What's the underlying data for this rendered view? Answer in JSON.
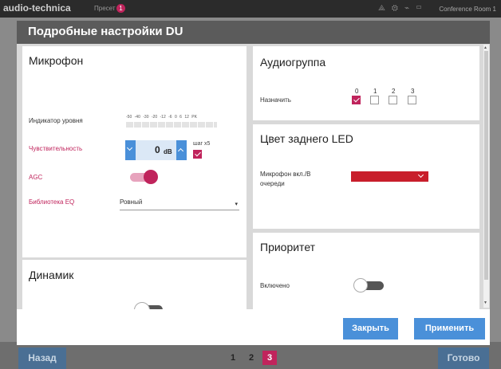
{
  "app": {
    "brand": "audio-technica",
    "preset_label": "Пресет",
    "preset_number": "1",
    "room": "Conference Room 1",
    "back_button": "Назад",
    "done_button": "Готово",
    "pages": [
      "1",
      "2",
      "3"
    ],
    "active_page": "3"
  },
  "modal": {
    "title": "Подробные настройки DU",
    "microphone": {
      "title": "Микрофон",
      "level_label": "Индикатор уровня",
      "meter_scale": [
        "-50",
        "-40",
        "-30",
        "-20",
        "-12",
        "-6",
        "0",
        "6",
        "12",
        "PK"
      ],
      "sensitivity_label": "Чувствительность",
      "sensitivity_value": "0",
      "sensitivity_unit": "dB",
      "step_label": "шаг x5",
      "step_checked": true,
      "agc_label": "AGC",
      "agc_on": true,
      "eq_label": "Библиотека EQ",
      "eq_value": "Ровный"
    },
    "speaker": {
      "title": "Динамик"
    },
    "audio_group": {
      "title": "Аудиогруппа",
      "assign_label": "Назначить",
      "groups": [
        "0",
        "1",
        "2",
        "3"
      ],
      "checked_group": "0"
    },
    "rear_led": {
      "title": "Цвет заднего LED",
      "mic_label": "Микрофон вкл./В очереди",
      "color": "#c81e2b"
    },
    "priority": {
      "title": "Приоритет",
      "enabled_label": "Включено",
      "enabled_on": false
    },
    "close_button": "Закрыть",
    "apply_button": "Применить"
  },
  "colors": {
    "accent": "#c0245c",
    "button_blue": "#4a90d9",
    "header_dark": "#5b5b5b"
  }
}
